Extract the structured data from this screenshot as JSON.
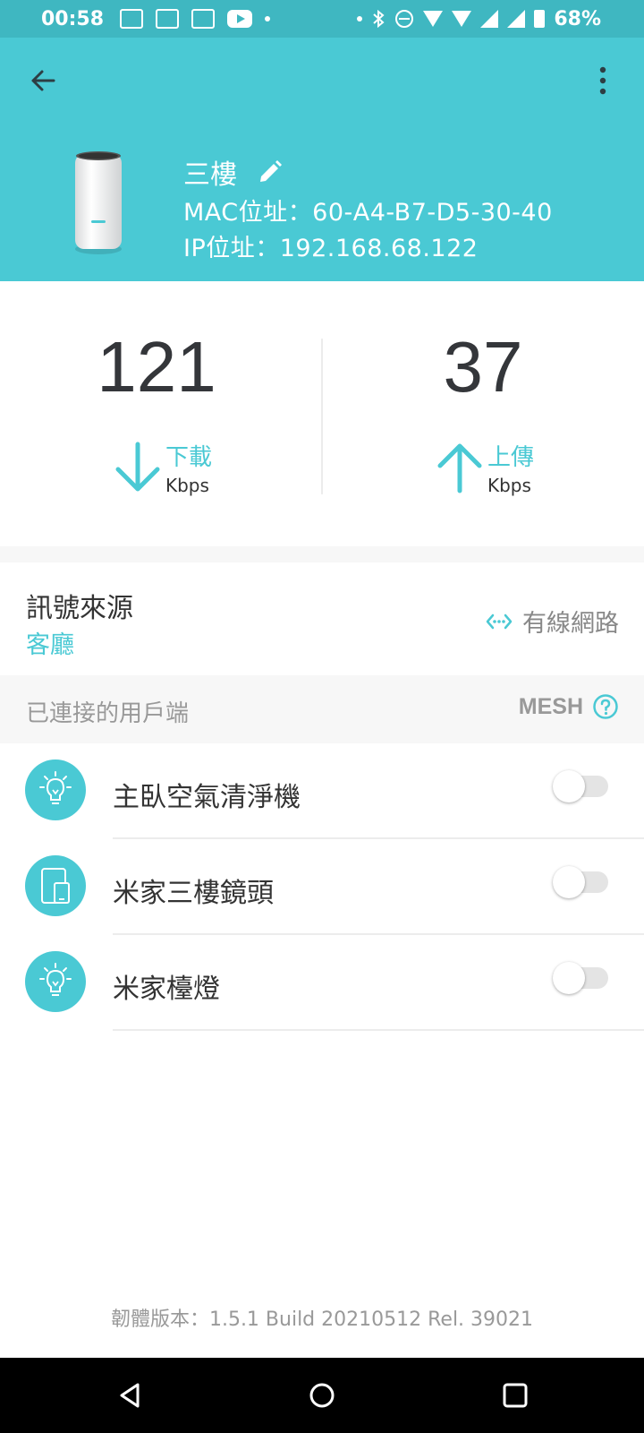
{
  "status_bar": {
    "time": "00:58",
    "battery": "68%",
    "icons": [
      "notification-icons",
      "youtube-icon",
      "bluetooth-icon",
      "dnd-icon",
      "wifi-icon",
      "signal-icon",
      "battery-icon"
    ]
  },
  "header": {
    "device_name": "三樓",
    "mac": "MAC位址：60-A4-B7-D5-30-40",
    "ip": "IP位址：192.168.68.122"
  },
  "speed": {
    "download": {
      "value": "121",
      "label": "下載",
      "unit": "Kbps"
    },
    "upload": {
      "value": "37",
      "label": "上傳",
      "unit": "Kbps"
    }
  },
  "source": {
    "title": "訊號來源",
    "value": "客廳",
    "connection": "有線網路"
  },
  "clients": {
    "title": "已連接的用戶端",
    "mesh_label": "MESH",
    "items": [
      {
        "name": "主臥空氣清淨機",
        "icon": "bulb-icon",
        "enabled": false
      },
      {
        "name": "米家三樓鏡頭",
        "icon": "device-icon",
        "enabled": false
      },
      {
        "name": "米家檯燈",
        "icon": "bulb-icon",
        "enabled": false
      }
    ]
  },
  "firmware": "韌體版本：1.5.1 Build 20210512 Rel. 39021",
  "colors": {
    "accent": "#4ac9d4",
    "status_bar": "#3fb7c1",
    "text": "#333333"
  }
}
